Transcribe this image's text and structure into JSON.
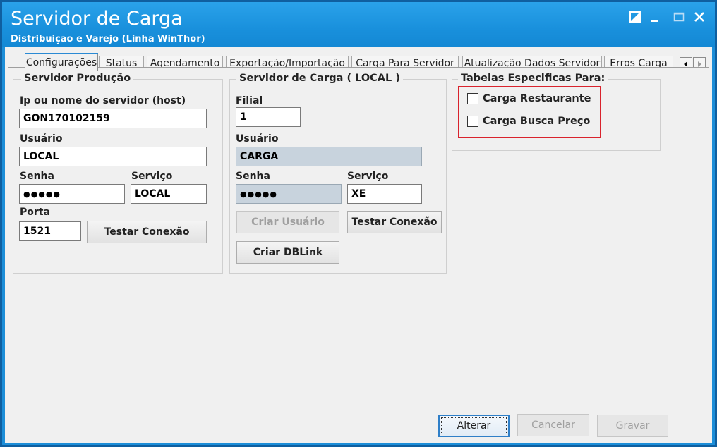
{
  "window": {
    "title": "Servidor de Carga",
    "subtitle": "Distribuição e Varejo (Linha WinThor)",
    "accent_color": "#1a8fdb",
    "controls": [
      "restore-icon",
      "minimize-icon",
      "maximize-icon",
      "close-icon"
    ]
  },
  "tabs": [
    {
      "label": "Configurações",
      "active": true
    },
    {
      "label": "Status",
      "active": false
    },
    {
      "label": "Agendamento",
      "active": false
    },
    {
      "label": "Exportação/Importação",
      "active": false
    },
    {
      "label": "Carga Para Servidor",
      "active": false
    },
    {
      "label": "Atualização Dados Servidor",
      "active": false
    },
    {
      "label": "Erros Carga",
      "active": false
    }
  ],
  "producao": {
    "title": "Servidor Produção",
    "host_label": "Ip ou nome do servidor (host)",
    "host_value": "GON170102159",
    "usuario_label": "Usuário",
    "usuario_value": "LOCAL",
    "senha_label": "Senha",
    "senha_value": "●●●●●",
    "servico_label": "Serviço",
    "servico_value": "LOCAL",
    "porta_label": "Porta",
    "porta_value": "1521",
    "testar_label": "Testar Conexão"
  },
  "carga": {
    "title": "Servidor de Carga ( LOCAL )",
    "filial_label": "Filial",
    "filial_value": "1",
    "usuario_label": "Usuário",
    "usuario_value": "CARGA",
    "senha_label": "Senha",
    "senha_value": "●●●●●",
    "servico_label": "Serviço",
    "servico_value": "XE",
    "criar_usuario_label": "Criar Usuário",
    "testar_label": "Testar Conexão",
    "criar_dblink_label": "Criar DBLink"
  },
  "tabelas": {
    "title": "Tabelas Especificas Para:",
    "restaurante_label": "Carga Restaurante",
    "restaurante_checked": false,
    "busca_preco_label": "Carga Busca Preço",
    "busca_preco_checked": false,
    "highlight_color": "#d9232d"
  },
  "footer": {
    "alterar_label": "Alterar",
    "cancelar_label": "Cancelar",
    "gravar_label": "Gravar"
  }
}
